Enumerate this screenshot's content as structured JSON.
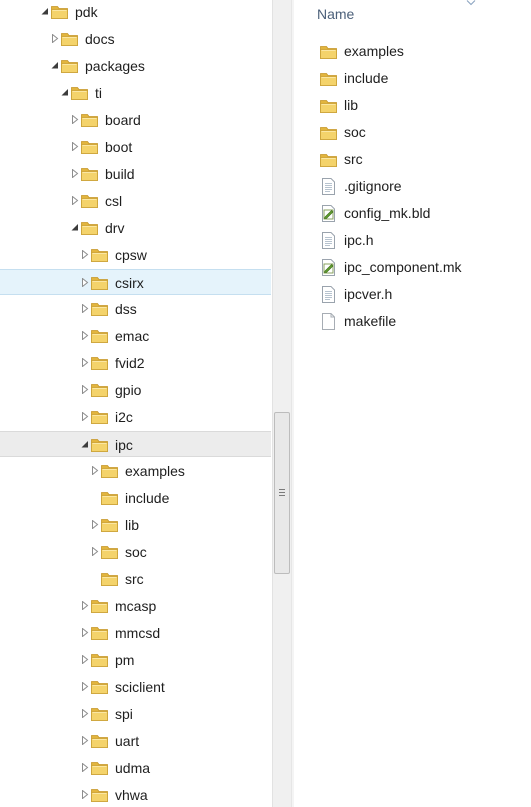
{
  "tree": {
    "items": [
      {
        "label": "pdk",
        "expander": "expanded",
        "depth": 0
      },
      {
        "label": "docs",
        "expander": "collapsed",
        "depth": 1
      },
      {
        "label": "packages",
        "expander": "expanded",
        "depth": 1
      },
      {
        "label": "ti",
        "expander": "expanded",
        "depth": 2
      },
      {
        "label": "board",
        "expander": "collapsed",
        "depth": 3
      },
      {
        "label": "boot",
        "expander": "collapsed",
        "depth": 3
      },
      {
        "label": "build",
        "expander": "collapsed",
        "depth": 3
      },
      {
        "label": "csl",
        "expander": "collapsed",
        "depth": 3
      },
      {
        "label": "drv",
        "expander": "expanded",
        "depth": 3
      },
      {
        "label": "cpsw",
        "expander": "collapsed",
        "depth": 4
      },
      {
        "label": "csirx",
        "expander": "collapsed",
        "depth": 4,
        "state": "hover"
      },
      {
        "label": "dss",
        "expander": "collapsed",
        "depth": 4
      },
      {
        "label": "emac",
        "expander": "collapsed",
        "depth": 4
      },
      {
        "label": "fvid2",
        "expander": "collapsed",
        "depth": 4
      },
      {
        "label": "gpio",
        "expander": "collapsed",
        "depth": 4
      },
      {
        "label": "i2c",
        "expander": "collapsed",
        "depth": 4
      },
      {
        "label": "ipc",
        "expander": "expanded",
        "depth": 4,
        "state": "selected"
      },
      {
        "label": "examples",
        "expander": "collapsed",
        "depth": 5
      },
      {
        "label": "include",
        "expander": "none",
        "depth": 5
      },
      {
        "label": "lib",
        "expander": "collapsed",
        "depth": 5
      },
      {
        "label": "soc",
        "expander": "collapsed",
        "depth": 5
      },
      {
        "label": "src",
        "expander": "none",
        "depth": 5
      },
      {
        "label": "mcasp",
        "expander": "collapsed",
        "depth": 4
      },
      {
        "label": "mmcsd",
        "expander": "collapsed",
        "depth": 4
      },
      {
        "label": "pm",
        "expander": "collapsed",
        "depth": 4
      },
      {
        "label": "sciclient",
        "expander": "collapsed",
        "depth": 4
      },
      {
        "label": "spi",
        "expander": "collapsed",
        "depth": 4
      },
      {
        "label": "uart",
        "expander": "collapsed",
        "depth": 4
      },
      {
        "label": "udma",
        "expander": "collapsed",
        "depth": 4
      },
      {
        "label": "vhwa",
        "expander": "collapsed",
        "depth": 4
      }
    ]
  },
  "file_list": {
    "column_header": "Name",
    "items": [
      {
        "label": "examples",
        "icon": "folder-icon"
      },
      {
        "label": "include",
        "icon": "folder-icon"
      },
      {
        "label": "lib",
        "icon": "folder-icon"
      },
      {
        "label": "soc",
        "icon": "folder-icon"
      },
      {
        "label": "src",
        "icon": "folder-icon"
      },
      {
        "label": ".gitignore",
        "icon": "text-file-icon"
      },
      {
        "label": "config_mk.bld",
        "icon": "edit-file-icon"
      },
      {
        "label": "ipc.h",
        "icon": "text-file-icon"
      },
      {
        "label": "ipc_component.mk",
        "icon": "edit-file-icon"
      },
      {
        "label": "ipcver.h",
        "icon": "text-file-icon"
      },
      {
        "label": "makefile",
        "icon": "blank-file-icon"
      }
    ]
  },
  "colors": {
    "hover_bg": "#e5f3fb",
    "selected_bg": "#ececec",
    "header_text": "#4c607a",
    "folder_yellow": "#f0c94c"
  }
}
